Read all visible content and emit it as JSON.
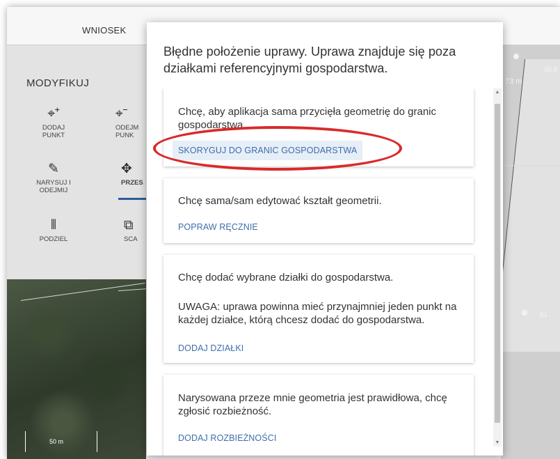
{
  "app": {
    "tab_label": "WNIOSEK",
    "panel_heading": "MODYFIKUJ",
    "tools": [
      {
        "icon": "add-point-icon",
        "glyph": "⌖⁺",
        "label": "DODAJ PUNKT"
      },
      {
        "icon": "remove-point-icon",
        "glyph": "⌖⁻",
        "label": "ODEJM PUNK"
      },
      {
        "icon": "draw-subtract-icon",
        "glyph": "✎",
        "label": "NARYSUJ I ODEJMIJ"
      },
      {
        "icon": "move-icon",
        "glyph": "✥",
        "label": "PRZES"
      },
      {
        "icon": "split-icon",
        "glyph": "⫴",
        "label": "PODZIEL"
      },
      {
        "icon": "merge-icon",
        "glyph": "⧉",
        "label": "SCA"
      }
    ]
  },
  "map": {
    "scale_label": "50 m",
    "right_labels": [
      "73 m",
      "65.5",
      "61"
    ]
  },
  "dialog": {
    "title": "Błędne położenie uprawy. Uprawa znajduje się poza działkami referencyjnymi gospodarstwa.",
    "options": [
      {
        "text": "Chcę, aby aplikacja sama przycięła geometrię do granic gospodarstwa.",
        "action": "SKORYGUJ DO GRANIC GOSPODARSTWA"
      },
      {
        "text": "Chcę sama/sam edytować kształt geometrii.",
        "action": "POPRAW RĘCZNIE"
      },
      {
        "text": "Chcę dodać wybrane działki do gospodarstwa.",
        "note": "UWAGA: uprawa powinna mieć przynajmniej jeden punkt na każdej działce, którą chcesz dodać do gospodarstwa.",
        "action": "DODAJ DZIAŁKI"
      },
      {
        "text": "Narysowana przeze mnie geometria jest prawidłowa, chcę zgłosić rozbieżność.",
        "action": "DODAJ ROZBIEŻNOŚCI"
      }
    ]
  },
  "colors": {
    "accent": "#3f6eab",
    "highlight_oval": "#d92a2a",
    "active_tab_underline": "#2b5d9b"
  }
}
